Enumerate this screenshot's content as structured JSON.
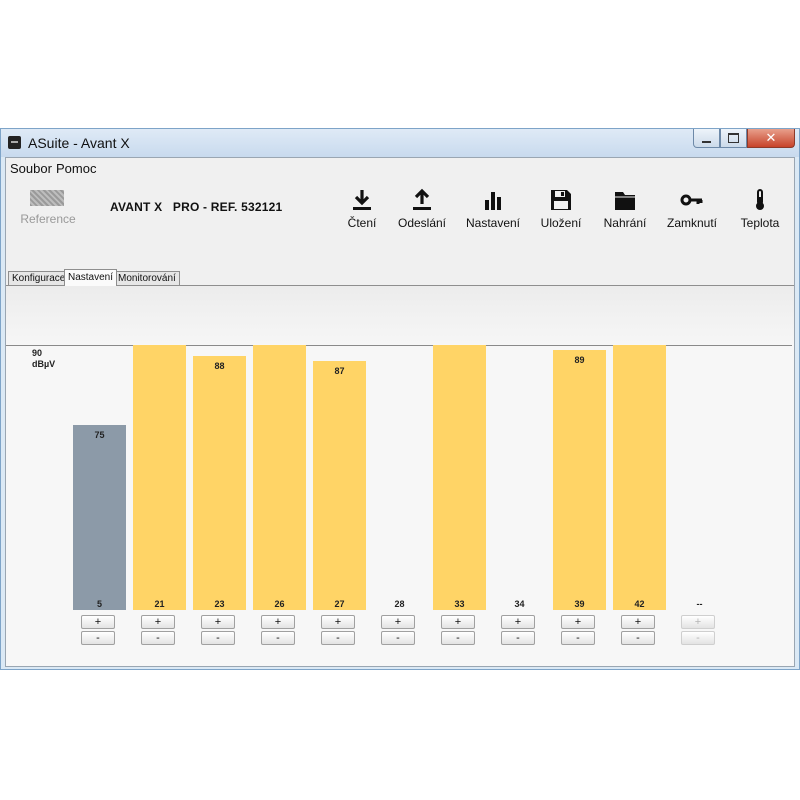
{
  "window": {
    "title": "ASuite - Avant X",
    "close_glyph": "✕"
  },
  "menu": [
    "Soubor",
    "Pomoc"
  ],
  "toolbar": {
    "reference_label": "Reference",
    "device_name": "AVANT X   PRO - REF. 532121",
    "buttons": [
      {
        "label": "Čtení",
        "icon": "download-icon"
      },
      {
        "label": "Odeslání",
        "icon": "upload-icon"
      },
      {
        "label": "Nastavení",
        "icon": "bar-chart-icon"
      },
      {
        "label": "Uložení",
        "icon": "floppy-disk-icon"
      },
      {
        "label": "Nahrání",
        "icon": "folder-icon"
      },
      {
        "label": "Zamknutí",
        "icon": "key-icon"
      },
      {
        "label": "Teplota",
        "icon": "thermometer-icon"
      }
    ]
  },
  "tabs": [
    {
      "label": "Konfigurace",
      "active": false
    },
    {
      "label": "Nastavení",
      "active": true
    },
    {
      "label": "Monitorování",
      "active": false
    }
  ],
  "chart_data": {
    "type": "bar",
    "reference_level": {
      "value": "90",
      "unit": "dBµV"
    },
    "categories": [
      "5",
      "21",
      "23",
      "26",
      "27",
      "28",
      "33",
      "34",
      "39",
      "42",
      "--"
    ],
    "values": [
      75,
      90,
      88,
      90,
      87,
      null,
      90,
      null,
      89,
      90,
      null
    ],
    "value_labels": [
      "75",
      "",
      "88",
      "",
      "87",
      "",
      "",
      "",
      "89",
      "",
      ""
    ],
    "ylim": [
      40,
      90
    ],
    "bar_colors": [
      "#8c9aa8",
      "#ffd466",
      "#ffd466",
      "#ffd466",
      "#ffd466",
      "#ffd466",
      "#ffd466",
      "#ffd466",
      "#ffd466",
      "#ffd466",
      "#ffd466"
    ]
  },
  "controls": {
    "plus": "+",
    "minus": "-"
  },
  "colors": {
    "bar_active": "#ffd466",
    "bar_selected": "#8c9aa8",
    "window_frame": "#dbe9f5"
  }
}
